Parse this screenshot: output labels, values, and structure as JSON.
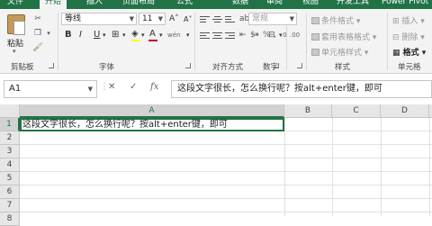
{
  "ribbon_tabs": [
    "文件",
    "开始",
    "插入",
    "页面布局",
    "公式",
    "数据",
    "审阅",
    "视图",
    "开发工具",
    "Power Pivot"
  ],
  "clipboard": {
    "paste_label": "粘贴",
    "group_label": "剪贴板"
  },
  "font": {
    "name": "等线",
    "size": "11",
    "group_label": "字体",
    "bold": "B",
    "italic": "I",
    "underline": "U",
    "font_color_glyph": "A",
    "grow_glyph": "A˄",
    "shrink_glyph": "A˅",
    "wen_glyph": "wén"
  },
  "alignment": {
    "group_label": "对齐方式"
  },
  "number": {
    "format": "常规",
    "group_label": "数字",
    "percent": "%",
    "comma": ",",
    "currency": "$"
  },
  "styles": {
    "conditional": "条件格式",
    "table_format": "套用表格格式",
    "cell_styles": "单元格样式",
    "group_label": "样式"
  },
  "cells": {
    "insert": "插入",
    "delete": "删除",
    "format": "格式",
    "group_label": "单元格"
  },
  "formula_bar": {
    "name_box": "A1",
    "cancel": "✕",
    "enter": "✓",
    "fx": "fx",
    "formula": "这段文字很长，怎么换行呢？按alt+enter键，即可"
  },
  "columns": [
    "A",
    "B",
    "C",
    "D"
  ],
  "rows": [
    "1",
    "2",
    "3",
    "4",
    "5",
    "6",
    "7",
    "8"
  ],
  "cell_a1": "这段文字很长，怎么换行呢？按alt+enter键，即可",
  "colors": {
    "accent": "#217346",
    "font_color_bar": "#c00000",
    "fill_bar": "#ffff00"
  }
}
